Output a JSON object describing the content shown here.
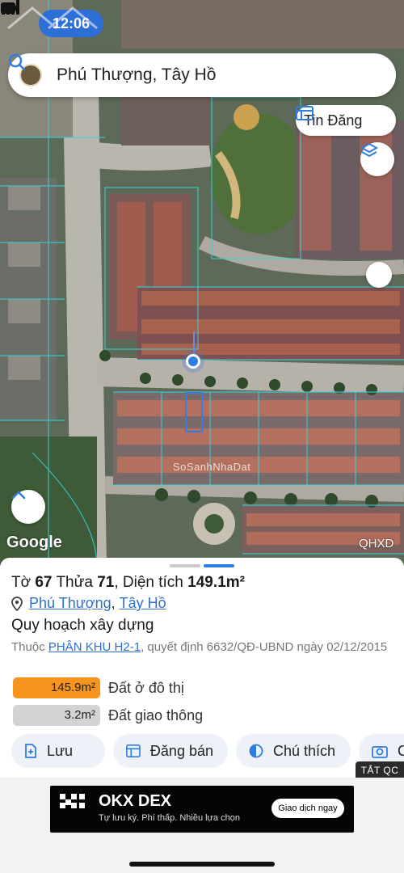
{
  "status_bar": {
    "time": "12:06"
  },
  "search": {
    "text": "Phú Thượng, Tây Hồ",
    "icon": "search-icon"
  },
  "map": {
    "tin_dang_label": "Tin Đăng",
    "google_label": "Google",
    "layer_label": "QHXD",
    "watermark": "SoSanhNhaDat"
  },
  "parcel": {
    "to_label": "Tờ",
    "to_value": "67",
    "thua_label": "Thửa",
    "thua_value": "71",
    "area_label": "Diện tích",
    "area_value": "149.1m²",
    "ward": "Phú Thượng",
    "district": "Tây Hồ",
    "plan_heading": "Quy hoạch xây dựng",
    "plan_prefix": "Thuộc",
    "plan_zone": "PHÂN KHU H2-1",
    "plan_suffix": ", quyết định 6632/QĐ-UBND ngày 02/12/2015",
    "areas": [
      {
        "value": "145.9m²",
        "label": "Đất ở đô thị",
        "color": "#f7941d"
      },
      {
        "value": "3.2m²",
        "label": "Đất giao thông",
        "color": "#d3d3d3"
      }
    ]
  },
  "actions": [
    {
      "label": "Lưu",
      "icon": "save-plus-icon"
    },
    {
      "label": "Đăng bán",
      "icon": "listing-icon"
    },
    {
      "label": "Chú thích",
      "icon": "legend-icon"
    },
    {
      "label": "C",
      "icon": "camera-icon"
    }
  ],
  "ad": {
    "tag": "TẮT QC",
    "brand": "OKX DEX",
    "tagline": "Tự lưu ký. Phí thấp. Nhiều lựa chọn",
    "cta": "Giao dịch ngay"
  },
  "colors": {
    "accent": "#2f7de1",
    "orange": "#f7941d"
  }
}
